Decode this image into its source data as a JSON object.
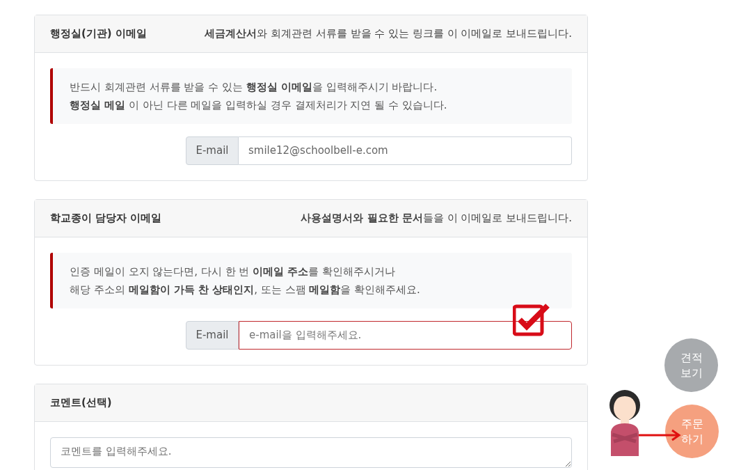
{
  "sections": [
    {
      "title": "행정실(기관) 이메일",
      "note": "**세금계산서**와 회계관련 서류를 받을 수 있는 링크를 이 이메일로 보내드립니다.",
      "callout": [
        "반드시 회계관련 서류를 받을 수 있는 **행정실 이메일**을 입력해주시기 바랍니다.",
        "**행정실 메일** 이 아닌 다른 메일을 입력하실 경우 결제처리가 지연 될 수 있습니다."
      ],
      "field": {
        "kind": "email",
        "label": "E-mail",
        "value": "smile12@schoolbell-e.com",
        "invalid": false
      },
      "check_mark": false
    },
    {
      "title": "학교종이 담당자 이메일",
      "note": "**사용설명서와 필요한 문서**들을 이 이메일로 보내드립니다.",
      "callout": [
        "인증 메일이 오지 않는다면, 다시 한 번 **이메일 주소**를 확인해주시거나",
        "해당 주소의 **메일함이 가득 찬 상태인지**, 또는 스팸 **메일함**을 확인해주세요."
      ],
      "field": {
        "kind": "email",
        "label": "E-mail",
        "placeholder": "e-mail을 입력해주세요.",
        "invalid": true
      },
      "check_mark": true
    },
    {
      "title": "코멘트(선택)",
      "field": {
        "kind": "comment",
        "placeholder": "코멘트를 입력해주세요."
      },
      "check_mark": false
    }
  ],
  "float_buttons": [
    {
      "label": "견적\n보기",
      "color": "#a7aaad"
    },
    {
      "label": "주문\n하기",
      "color": "#f5a07f"
    }
  ]
}
